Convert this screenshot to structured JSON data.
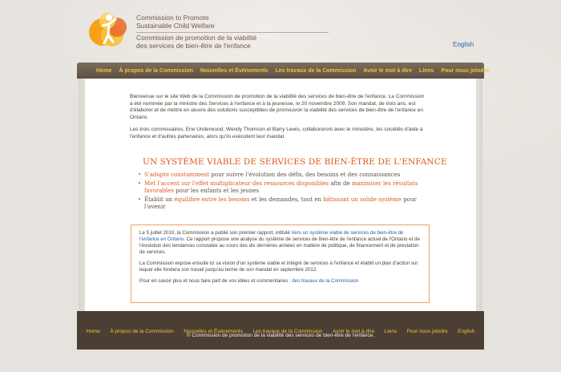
{
  "header": {
    "org_name_en_line1": "Commission to Promote",
    "org_name_en_line2": "Sustainable Child Welfare",
    "org_name_fr_line1": "Commission de promotion de la viabilité",
    "org_name_fr_line2": "des services de bien-être de l'enfance",
    "language_link": "English"
  },
  "nav": {
    "items": [
      "Home",
      "À propos de la Commission",
      "Nouvelles et Événements",
      "Les travaux de la Commission",
      "Avoir le mot à dire",
      "Liens",
      "Pour nous joindre"
    ]
  },
  "intro": {
    "p1": "Bienvenue sur le site Web de la Commission de promotion de la viabilité des services de bien-être de l'enfance. La Commission a été nommée par la ministre des Services à l'enfance et à la jeunesse, le 20 novembre 2009. Son mandat, de trois ans, est d'élaborer et de mettre en œuvre des solutions susceptibles de promouvoir la viabilité des services de bien-être de l'enfance en Ontario.",
    "p2": "Les trois commissaires, Ene Underwood, Wendy Thomson et Barry Lewis, collaboreront avec le ministère, les sociétés d'aide à l'enfance et d'autres partenaires, alors qu'ils exécutent leur mandat."
  },
  "headline": "UN SYSTÈME VIABLE DE SERVICES DE BIEN-ÊTRE DE L'ENFANCE",
  "bullets": {
    "b1_hl": "S'adapte constamment",
    "b1_rest": " pour suivre l'évolution des défis, des besoins et des connaissances",
    "b2_hl1": "Met l'accent sur l'effet multiplicateur des ressources disponibles",
    "b2_mid": " afin de ",
    "b2_hl2": "maximiser les résultats favorables",
    "b2_rest": " pour les enfants et les jeunes",
    "b3_pre": "Établit un ",
    "b3_hl1": "équilibre entre les besoins",
    "b3_mid": " et les demandes, tout en ",
    "b3_hl2": "bâtissant un solide système",
    "b3_rest": " pour l'avenir"
  },
  "box": {
    "p1_pre": "Le 5 juillet 2010, la Commission a publié son premier rapport, intitulé ",
    "p1_link": "Vers un système viable de services de bien-être de l'enfance en Ontario",
    "p1_rest": ". Ce rapport propose une analyse du système de services de bien-être de l'enfance actuel de l'Ontario et de l'évolution des tendances constatée au cours des dix dernières années en matière de politique, de financement et de prestation de services.",
    "p2": "La Commission expose ensuite ici sa vision d'un système viable et intégré de services à l'enfance et établit un plan d'action sur lequel elle fondera son travail jusqu'au terme de son mandat en septembre 2012.",
    "p3_pre": "Pour en savoir plus et nous faire part de vos idées et commentaires : ",
    "p3_link": "des travaux de la Commission"
  },
  "footer": {
    "items": [
      "Home",
      "À propos de la Commission",
      "Nouvelles et Événements",
      "Les travaux de la Commission",
      "Avoir le mot à dire",
      "Liens",
      "Pour nous joindre",
      "English"
    ],
    "copyright": "© Commission de promotion de la viabilité des services de bien-être de l'enfance."
  },
  "colors": {
    "accent_orange": "#e0561b",
    "nav_bg": "#5d5043",
    "nav_link": "#f5c23a",
    "link_blue": "#2a62a8"
  }
}
